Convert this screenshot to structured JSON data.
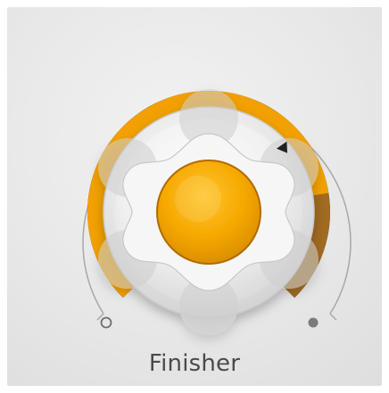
{
  "knob": {
    "label": "Finisher",
    "value_fraction": 0.8,
    "secondary_fraction": 0.2,
    "colors": {
      "accent": "#f2a100",
      "accent_dark": "#a06b22",
      "track": "#2f2f33",
      "background": "#ededed"
    }
  }
}
